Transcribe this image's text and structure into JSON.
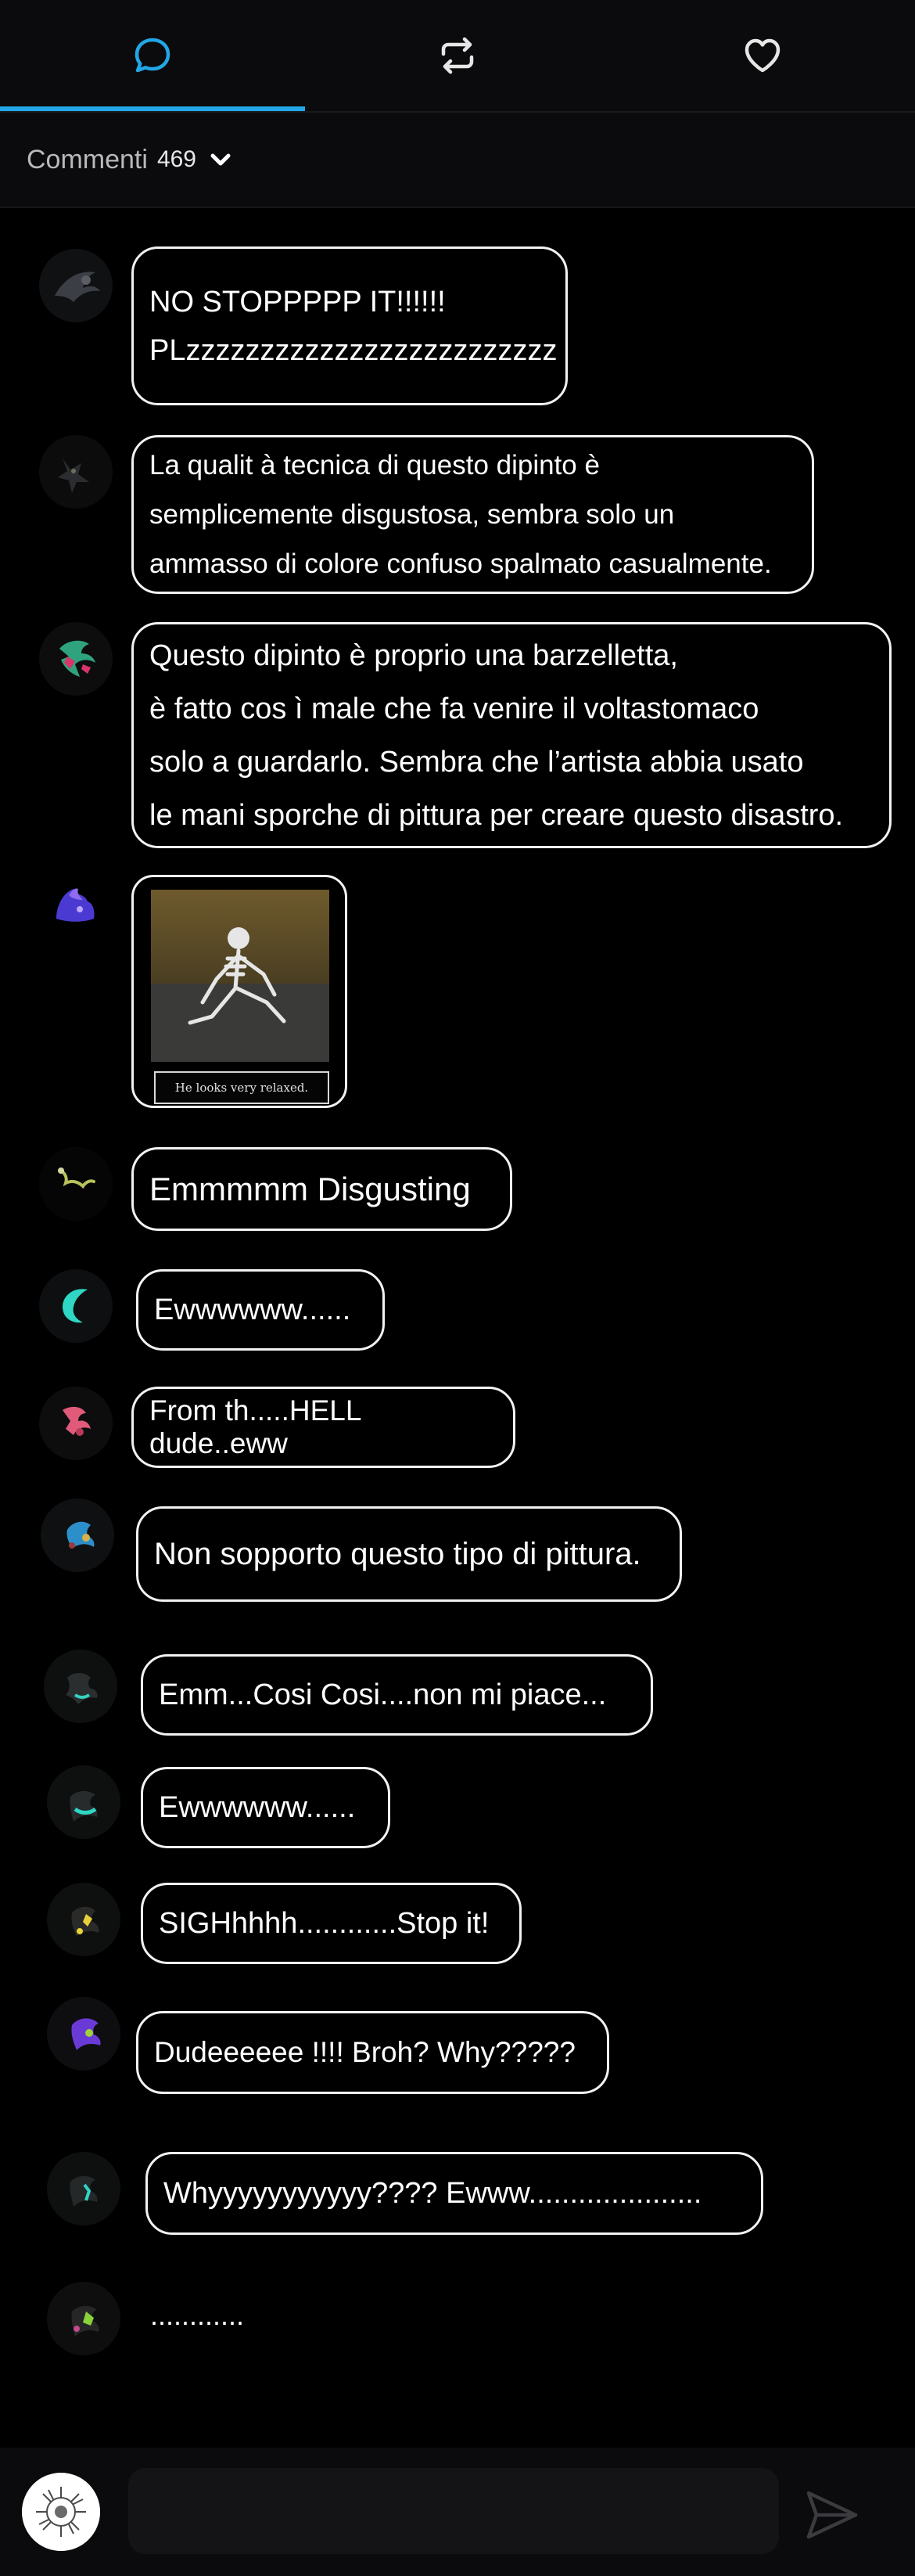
{
  "tabs": [
    {
      "id": "comments",
      "icon": "speech-bubble-icon",
      "active": true
    },
    {
      "id": "reposts",
      "icon": "repost-arrows-icon",
      "active": false
    },
    {
      "id": "likes",
      "icon": "heart-icon",
      "active": false
    }
  ],
  "accent_color": "#22a6e6",
  "comments_header": {
    "title": "Commenti",
    "count": "469"
  },
  "comments": [
    {
      "lines": [
        "NO STOPPPPP IT!!!!!!",
        "PLzzzzzzzzzzzzzzzzzzzzzzzzz"
      ]
    },
    {
      "lines": [
        "La qualit à  tecnica di questo dipinto  è",
        "semplicemente disgustosa, sembra solo un",
        "ammasso di colore confuso spalmato casualmente."
      ]
    },
    {
      "lines": [
        "Questo dipinto  è  proprio una barzelletta,",
        " è  fatto cos ì  male che fa venire il voltastomaco",
        "solo a guardarlo. Sembra che l’artista abbia usato",
        "le mani sporche di pittura per creare questo disastro."
      ]
    },
    {
      "image_caption": "He looks very relaxed."
    },
    {
      "lines": [
        "Emmmmm Disgusting"
      ]
    },
    {
      "lines": [
        "Ewwwwww......"
      ]
    },
    {
      "lines": [
        "From th.....HELL dude..eww"
      ]
    },
    {
      "lines": [
        "Non sopporto questo tipo di pittura."
      ]
    },
    {
      "lines": [
        "Emm...Cosi Cosi....non mi piace..."
      ]
    },
    {
      "lines": [
        "Ewwwwww......"
      ]
    },
    {
      "lines": [
        "SIGHhhhh............Stop it!"
      ]
    },
    {
      "lines": [
        "Dudeeeeee !!!! Broh? Why?????"
      ]
    },
    {
      "lines": [
        "Whyyyyyyyyyyy????  Ewww....................."
      ]
    },
    {
      "lines": [
        "............"
      ]
    }
  ],
  "input": {
    "placeholder": ""
  }
}
